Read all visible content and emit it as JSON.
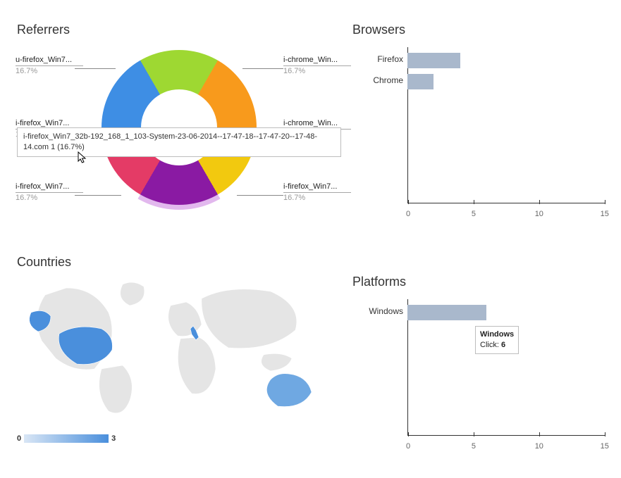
{
  "referrers": {
    "title": "Referrers",
    "labels": [
      {
        "text": "i-chrome_Win...",
        "pct": "16.7%"
      },
      {
        "text": "i-chrome_Win...",
        "pct": "16.7%"
      },
      {
        "text": "i-firefox_Win7...",
        "pct": "16.7%"
      },
      {
        "text": "i-firefox_Win7...",
        "pct": "16.7%"
      },
      {
        "text": "i-firefox_Win7...",
        "pct": "16.7%"
      },
      {
        "text": "u-firefox_Win7...",
        "pct": "16.7%"
      }
    ],
    "tooltip": "i-firefox_Win7_32b-192_168_1_103-System-23-06-2014--17-47-18--17-47-20--17-48-14.com  1 (16.7%)"
  },
  "browsers": {
    "title": "Browsers",
    "categories": [
      "Firefox",
      "Chrome"
    ]
  },
  "countries": {
    "title": "Countries",
    "legend_min": "0",
    "legend_max": "3"
  },
  "platforms": {
    "title": "Platforms",
    "categories": [
      "Windows"
    ],
    "tooltip_line1": "Windows",
    "tooltip_line2": "Click: 6"
  },
  "axis_ticks": [
    "0",
    "5",
    "10",
    "15"
  ],
  "chart_data": [
    {
      "type": "pie",
      "title": "Referrers",
      "series": [
        {
          "name": "i-chrome_Win...",
          "value": 1,
          "pct": 16.7,
          "color": "#3e8ee4"
        },
        {
          "name": "i-chrome_Win...",
          "value": 1,
          "pct": 16.7,
          "color": "#9ed832"
        },
        {
          "name": "i-firefox_Win7...",
          "value": 1,
          "pct": 16.7,
          "color": "#f89a1c"
        },
        {
          "name": "i-firefox_Win7...",
          "value": 1,
          "pct": 16.7,
          "color": "#f2c90f"
        },
        {
          "name": "i-firefox_Win7...",
          "value": 1,
          "pct": 16.7,
          "color": "#8a1aa3"
        },
        {
          "name": "u-firefox_Win7...",
          "value": 1,
          "pct": 16.7,
          "color": "#e43b66"
        }
      ],
      "highlighted_index": 4
    },
    {
      "type": "bar",
      "orientation": "horizontal",
      "title": "Browsers",
      "categories": [
        "Firefox",
        "Chrome"
      ],
      "values": [
        4,
        2
      ],
      "xlabel": "",
      "ylabel": "",
      "xlim": [
        0,
        15
      ]
    },
    {
      "type": "heatmap",
      "title": "Countries",
      "legend_range": [
        0,
        3
      ],
      "note": "World choropleth; visibly shaded countries only.",
      "data": [
        {
          "country": "United States",
          "value": 3
        },
        {
          "country": "Australia",
          "value": 2
        },
        {
          "country": "Italy",
          "value": 1
        }
      ]
    },
    {
      "type": "bar",
      "orientation": "horizontal",
      "title": "Platforms",
      "categories": [
        "Windows"
      ],
      "values": [
        6
      ],
      "xlabel": "",
      "ylabel": "",
      "xlim": [
        0,
        15
      ]
    }
  ]
}
